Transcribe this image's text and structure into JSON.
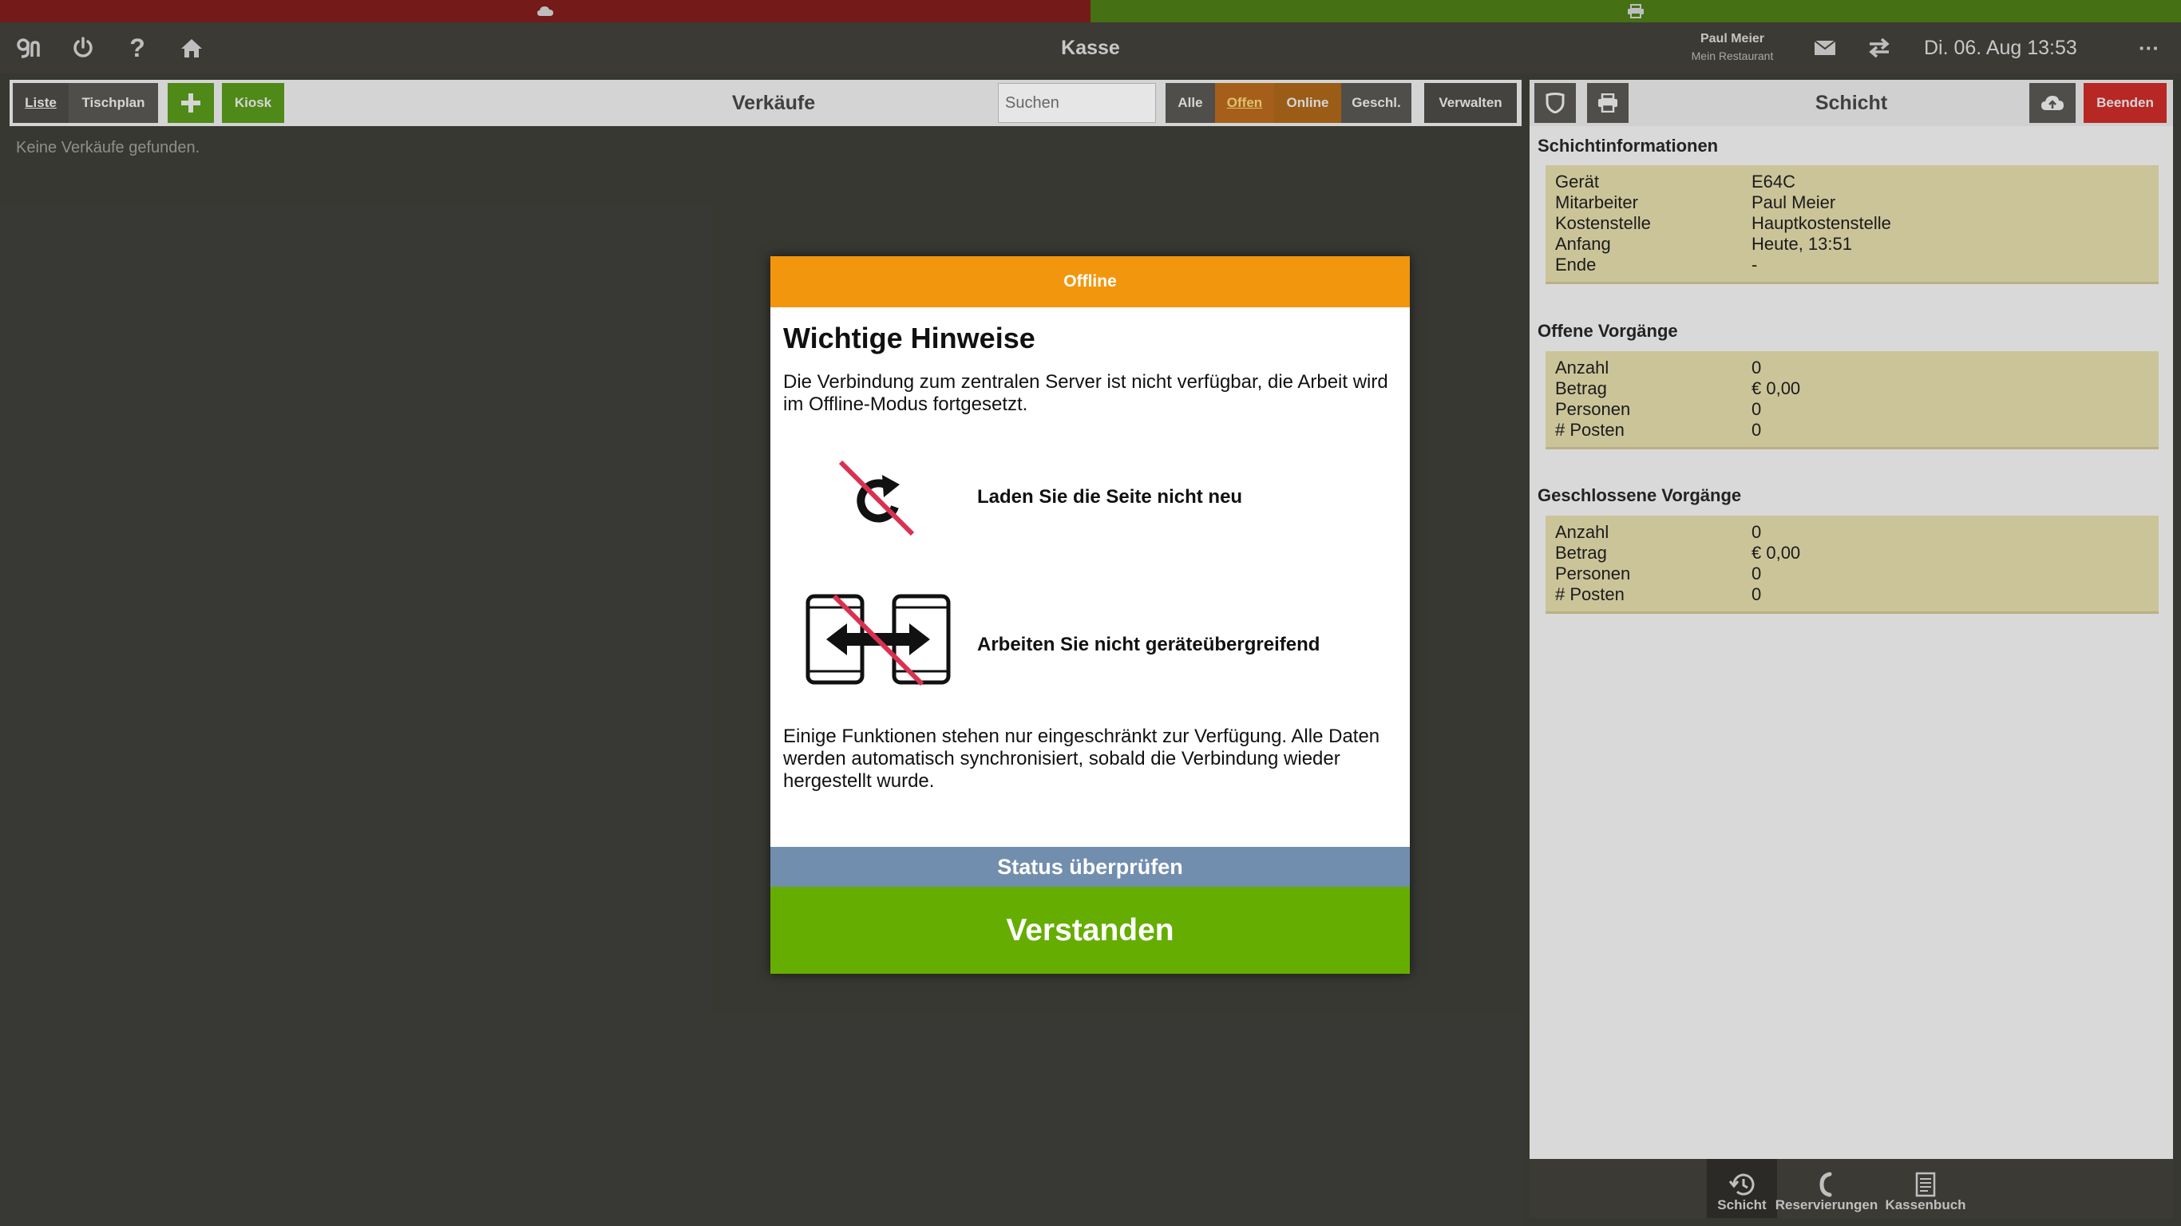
{
  "colors": {
    "status_left": "#7e1d1b",
    "status_right": "#4b7a16",
    "offline_header": "#f2960d",
    "primary_button": "#65ad00",
    "secondary_button": "#728eaf",
    "info_box": "#ddd5a6",
    "danger": "#c72b28"
  },
  "topbar": {
    "title": "Kasse",
    "user_name": "Paul Meier",
    "restaurant": "Mein Restaurant",
    "datetime": "Di. 06. Aug 13:53",
    "icons": [
      "logo-icon",
      "power-icon",
      "help-icon",
      "home-icon",
      "mail-icon",
      "sync-icon",
      "more-icon"
    ]
  },
  "sales": {
    "tab_list": "Liste",
    "tab_table_plan": "Tischplan",
    "kiosk": "Kiosk",
    "title": "Verkäufe",
    "search_placeholder": "Suchen",
    "filter_all": "Alle",
    "filter_open": "Offen",
    "filter_online": "Online",
    "filter_closed": "Geschl.",
    "manage": "Verwalten",
    "empty": "Keine Verkäufe gefunden."
  },
  "shift": {
    "title": "Schicht",
    "end_button": "Beenden",
    "info_heading": "Schichtinformationen",
    "info": [
      {
        "label": "Gerät",
        "value": "E64C"
      },
      {
        "label": "Mitarbeiter",
        "value": "Paul Meier"
      },
      {
        "label": "Kostenstelle",
        "value": "Hauptkostenstelle"
      },
      {
        "label": "Anfang",
        "value": "Heute, 13:51"
      },
      {
        "label": "Ende",
        "value": "-"
      }
    ],
    "open_heading": "Offene Vorgänge",
    "open": [
      {
        "label": "Anzahl",
        "value": "0"
      },
      {
        "label": "Betrag",
        "value": "€ 0,00"
      },
      {
        "label": "Personen",
        "value": "0"
      },
      {
        "label": "# Posten",
        "value": "0"
      }
    ],
    "closed_heading": "Geschlossene Vorgänge",
    "closed": [
      {
        "label": "Anzahl",
        "value": "0"
      },
      {
        "label": "Betrag",
        "value": "€ 0,00"
      },
      {
        "label": "Personen",
        "value": "0"
      },
      {
        "label": "# Posten",
        "value": "0"
      }
    ]
  },
  "bottom_nav": {
    "shift": "Schicht",
    "reservations": "Reservierungen",
    "cashbook": "Kassenbuch"
  },
  "modal": {
    "header": "Offline",
    "title": "Wichtige Hinweise",
    "intro": "Die Verbindung zum zentralen Server ist nicht verfügbar, die Arbeit wird im Offline-Modus fortgesetzt.",
    "hint_reload": "Laden Sie die Seite nicht neu",
    "hint_devices": "Arbeiten Sie nicht geräteübergreifend",
    "outro": "Einige Funktionen stehen nur eingeschränkt zur Verfügung. Alle Daten werden automatisch synchronisiert, sobald die Verbindung wieder hergestellt wurde.",
    "check_status": "Status überprüfen",
    "confirm": "Verstanden"
  }
}
